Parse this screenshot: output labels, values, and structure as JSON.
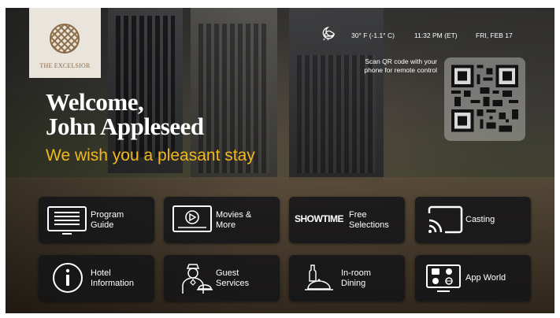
{
  "hotel": {
    "name": "THE EXCELSIOR"
  },
  "status": {
    "weather_icon": "moon-cloud-snow-icon",
    "temperature": "30° F (-1.1° C)",
    "time": "11:32 PM (ET)",
    "date": "FRI, FEB 17"
  },
  "qr": {
    "hint_line1": "Scan QR code with your",
    "hint_line2": "phone for remote control"
  },
  "welcome": {
    "line1": "Welcome,",
    "line2": "John Appleseed",
    "tagline": "We wish you a pleasant stay"
  },
  "colors": {
    "accent": "#f2b81d",
    "tile_bg": "#161618",
    "logo_brown": "#8a6a45"
  },
  "tiles": [
    {
      "id": "program-guide",
      "icon": "tv-guide-icon",
      "line1": "Program",
      "line2": "Guide"
    },
    {
      "id": "movies",
      "icon": "play-screen-icon",
      "line1": "Movies &",
      "line2": "More"
    },
    {
      "id": "free-selections",
      "icon": "showtime-logo",
      "logo_text": "SHOWTIME",
      "line1": "Free",
      "line2": "Selections"
    },
    {
      "id": "casting",
      "icon": "cast-icon",
      "line1": "Casting",
      "line2": ""
    },
    {
      "id": "hotel-information",
      "icon": "info-icon",
      "line1": "Hotel",
      "line2": "Information"
    },
    {
      "id": "guest-services",
      "icon": "concierge-icon",
      "line1": "Guest",
      "line2": "Services"
    },
    {
      "id": "in-room-dining",
      "icon": "dining-cloche-icon",
      "line1": "In-room",
      "line2": "Dining"
    },
    {
      "id": "app-world",
      "icon": "app-grid-screen-icon",
      "line1": "App World",
      "line2": ""
    }
  ]
}
